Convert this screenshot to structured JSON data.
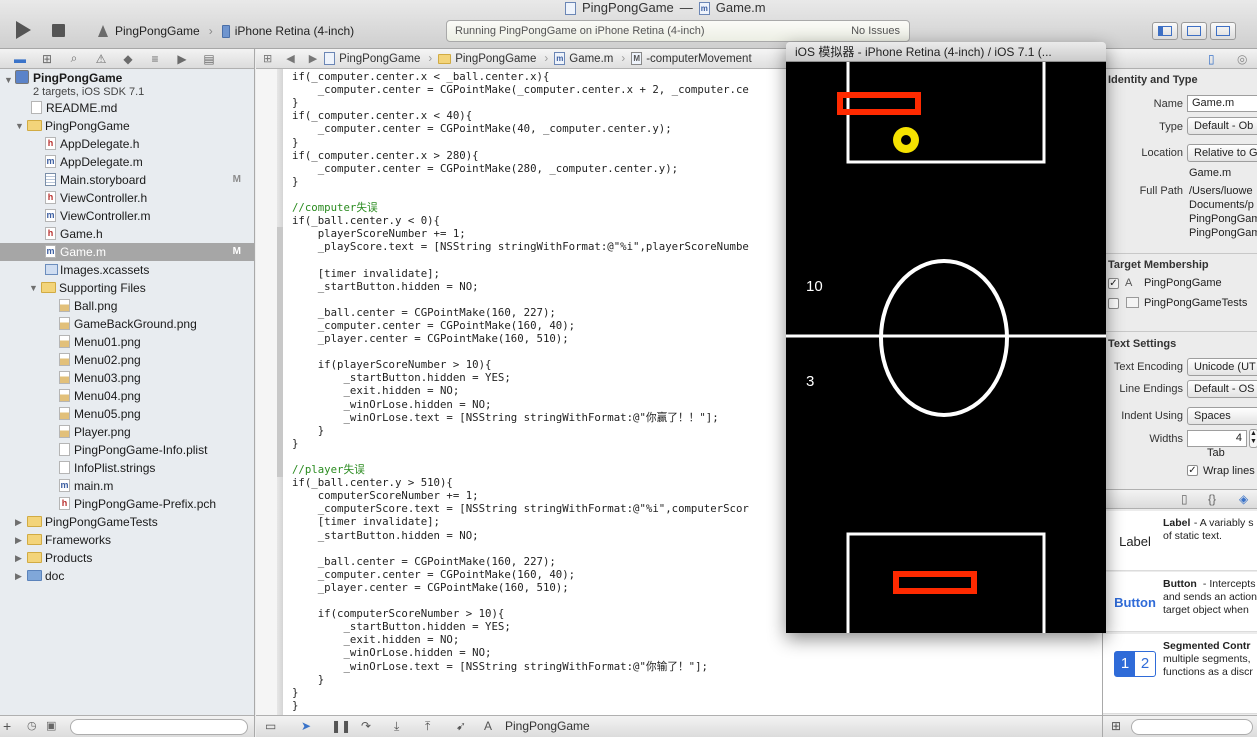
{
  "window": {
    "title": "PingPongGame",
    "title_sep": "—",
    "file": "Game.m"
  },
  "toolbar": {
    "scheme_app": "PingPongGame",
    "scheme_device": "iPhone Retina (4-inch)",
    "status_text": "Running PingPongGame on iPhone Retina (4-inch)",
    "issues_text": "No Issues"
  },
  "navigator": {
    "project": {
      "name": "PingPongGame",
      "subtitle": "2 targets, iOS SDK 7.1"
    },
    "rows": [
      {
        "label": "README.md",
        "icon": "document-icon"
      },
      {
        "label": "PingPongGame",
        "icon": "folder-icon"
      },
      {
        "label": "AppDelegate.h",
        "icon": "header-file-icon"
      },
      {
        "label": "AppDelegate.m",
        "icon": "implementation-file-icon"
      },
      {
        "label": "Main.storyboard",
        "icon": "storyboard-icon",
        "badge": "M"
      },
      {
        "label": "ViewController.h",
        "icon": "header-file-icon"
      },
      {
        "label": "ViewController.m",
        "icon": "implementation-file-icon"
      },
      {
        "label": "Game.h",
        "icon": "header-file-icon"
      },
      {
        "label": "Game.m",
        "icon": "implementation-file-icon",
        "badge": "M",
        "selected": true
      },
      {
        "label": "Images.xcassets",
        "icon": "asset-catalog-icon"
      },
      {
        "label": "Supporting Files",
        "icon": "folder-icon"
      },
      {
        "label": "Ball.png",
        "icon": "image-file-icon"
      },
      {
        "label": "GameBackGround.png",
        "icon": "image-file-icon"
      },
      {
        "label": "Menu01.png",
        "icon": "image-file-icon"
      },
      {
        "label": "Menu02.png",
        "icon": "image-file-icon"
      },
      {
        "label": "Menu03.png",
        "icon": "image-file-icon"
      },
      {
        "label": "Menu04.png",
        "icon": "image-file-icon"
      },
      {
        "label": "Menu05.png",
        "icon": "image-file-icon"
      },
      {
        "label": "Player.png",
        "icon": "image-file-icon"
      },
      {
        "label": "PingPongGame-Info.plist",
        "icon": "plist-file-icon"
      },
      {
        "label": "InfoPlist.strings",
        "icon": "strings-file-icon"
      },
      {
        "label": "main.m",
        "icon": "implementation-file-icon"
      },
      {
        "label": "PingPongGame-Prefix.pch",
        "icon": "header-file-icon"
      },
      {
        "label": "PingPongGameTests",
        "icon": "folder-icon"
      },
      {
        "label": "Frameworks",
        "icon": "folder-icon"
      },
      {
        "label": "Products",
        "icon": "folder-icon"
      },
      {
        "label": "doc",
        "icon": "blue-folder-icon"
      }
    ]
  },
  "editor": {
    "breadcrumbs": [
      "PingPongGame",
      "PingPongGame",
      "Game.m",
      "-computerMovement"
    ],
    "lines": [
      "if(_computer.center.x < _ball.center.x){",
      "    _computer.center = CGPointMake(_computer.center.x + 2, _computer.ce",
      "}",
      "if(_computer.center.x < 40){",
      "    _computer.center = CGPointMake(40, _computer.center.y);",
      "}",
      "if(_computer.center.x > 280){",
      "    _computer.center = CGPointMake(280, _computer.center.y);",
      "}",
      "",
      "//computer失误",
      "if(_ball.center.y < 0){",
      "    playerScoreNumber += 1;",
      "    _playScore.text = [NSString stringWithFormat:@\"%i\",playerScoreNumbe",
      "",
      "    [timer invalidate];",
      "    _startButton.hidden = NO;",
      "",
      "    _ball.center = CGPointMake(160, 227);",
      "    _computer.center = CGPointMake(160, 40);",
      "    _player.center = CGPointMake(160, 510);",
      "",
      "    if(playerScoreNumber > 10){",
      "        _startButton.hidden = YES;",
      "        _exit.hidden = NO;",
      "        _winOrLose.hidden = NO;",
      "        _winOrLose.text = [NSString stringWithFormat:@\"你赢了！！\"];",
      "    }",
      "}",
      "",
      "//player失误",
      "if(_ball.center.y > 510){",
      "    computerScoreNumber += 1;",
      "    _computerScore.text = [NSString stringWithFormat:@\"%i\",computerScor",
      "    [timer invalidate];",
      "    _startButton.hidden = NO;",
      "",
      "    _ball.center = CGPointMake(160, 227);",
      "    _computer.center = CGPointMake(160, 40);",
      "    _player.center = CGPointMake(160, 510);",
      "",
      "    if(computerScoreNumber > 10){",
      "        _startButton.hidden = YES;",
      "        _exit.hidden = NO;",
      "        _winOrLose.hidden = NO;",
      "        _winOrLose.text = [NSString stringWithFormat:@\"你输了！\"];",
      "    }",
      "}",
      "}"
    ],
    "debug_target": "PingPongGame"
  },
  "simulator": {
    "title": "iOS 模拟器 - iPhone Retina (4-inch) / iOS 7.1 (...",
    "computer_score": "10",
    "player_score": "3"
  },
  "inspector": {
    "identity_header": "Identity and Type",
    "name_label": "Name",
    "name_value": "Game.m",
    "type_label": "Type",
    "type_value": "Default - Ob",
    "location_label": "Location",
    "location_value": "Relative to G",
    "location_file": "Game.m",
    "full_path_label": "Full Path",
    "full_path_lines": [
      "/Users/luowe",
      "Documents/p",
      "PingPongGam",
      "PingPongGam"
    ],
    "target_header": "Target Membership",
    "targets": [
      {
        "label": "PingPongGame",
        "checked": true
      },
      {
        "label": "PingPongGameTests",
        "checked": false
      }
    ],
    "text_header": "Text Settings",
    "encoding_label": "Text Encoding",
    "encoding_value": "Unicode (UT",
    "line_endings_label": "Line Endings",
    "line_endings_value": "Default - OS",
    "indent_label": "Indent Using",
    "indent_value": "Spaces",
    "widths_label": "Widths",
    "widths_value": "4",
    "tab_label": "Tab",
    "wrap_label": "Wrap lines",
    "library": [
      {
        "preview": "Label",
        "title": "Label",
        "desc": " - A variably s\nof static text."
      },
      {
        "preview": "Button",
        "title": "Button",
        "desc": " - Intercepts\nand sends an action\ntarget object when"
      },
      {
        "preview": "12",
        "title": "Segmented Contr",
        "desc": "\nmultiple segments, \nfunctions as a discr"
      }
    ]
  }
}
